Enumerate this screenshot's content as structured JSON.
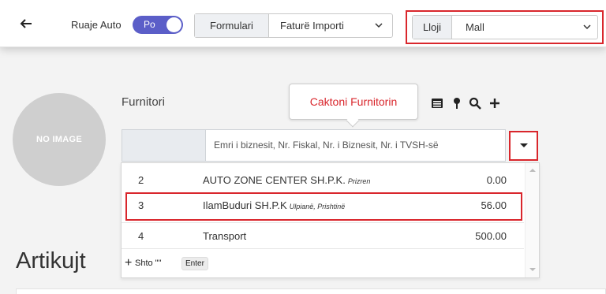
{
  "toolbar": {
    "autosave_label": "Ruaje Auto",
    "autosave_toggle": "Po",
    "form_label": "Formulari",
    "form_value": "Faturë Importi",
    "type_label": "Lloji",
    "type_value": "Mall"
  },
  "avatar": {
    "text": "NO IMAGE"
  },
  "supplier": {
    "label": "Furnitori",
    "tooltip": "Caktoni Furnitorin",
    "search_placeholder": "Emri i biznesit, Nr. Fiskal, Nr. i Biznesit, Nr. i TVSH-së"
  },
  "dropdown": {
    "items": [
      {
        "num": "2",
        "name": "AUTO ZONE CENTER SH.P.K.",
        "location": "Prizren",
        "amount": "0.00"
      },
      {
        "num": "3",
        "name": "IlamBuduri SH.P.K",
        "location": "Ulpianë, Prishtinë",
        "amount": "56.00"
      },
      {
        "num": "4",
        "name": "Transport",
        "location": "",
        "amount": "500.00"
      }
    ],
    "add_label": "Shto \"\"",
    "enter_key": "Enter"
  },
  "items_heading": "Artikujt",
  "colors": {
    "accent": "#5b5ec8",
    "highlight": "#d9262c"
  }
}
